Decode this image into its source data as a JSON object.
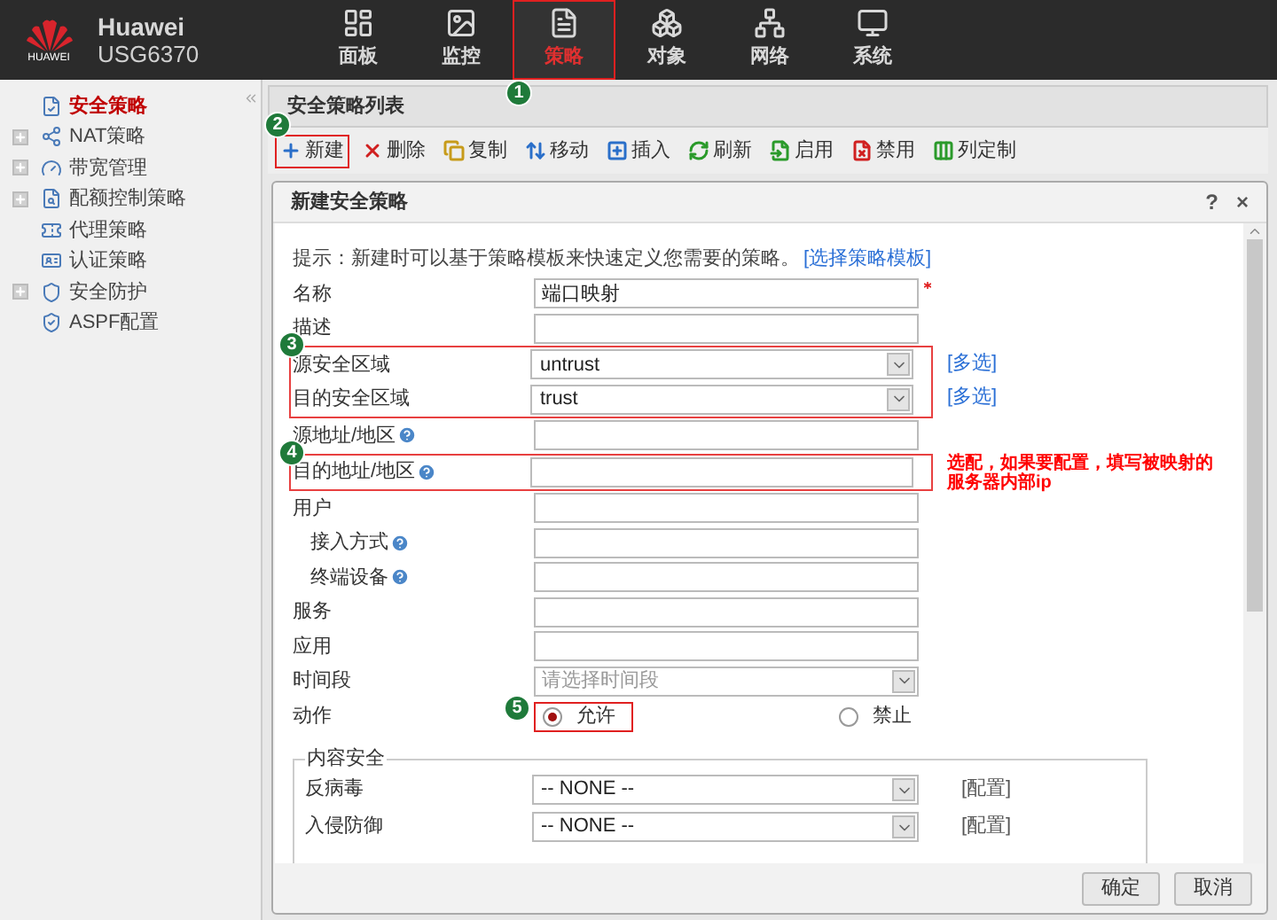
{
  "header": {
    "logo_text": "HUAWEI",
    "brand": "Huawei",
    "model": "USG6370",
    "nav": [
      {
        "label": "面板",
        "selected": false
      },
      {
        "label": "监控",
        "selected": false
      },
      {
        "label": "策略",
        "selected": true,
        "badge": "1"
      },
      {
        "label": "对象",
        "selected": false
      },
      {
        "label": "网络",
        "selected": false
      },
      {
        "label": "系统",
        "selected": false
      }
    ]
  },
  "sidebar": {
    "items": [
      {
        "label": "安全策略",
        "selected": true,
        "expandable": false
      },
      {
        "label": "NAT策略",
        "selected": false,
        "expandable": true
      },
      {
        "label": "带宽管理",
        "selected": false,
        "expandable": true
      },
      {
        "label": "配额控制策略",
        "selected": false,
        "expandable": true
      },
      {
        "label": "代理策略",
        "selected": false,
        "expandable": false
      },
      {
        "label": "认证策略",
        "selected": false,
        "expandable": false
      },
      {
        "label": "安全防护",
        "selected": false,
        "expandable": true
      },
      {
        "label": "ASPF配置",
        "selected": false,
        "expandable": false
      }
    ]
  },
  "panel": {
    "title": "安全策略列表",
    "toolbar": [
      {
        "label": "新建",
        "highlighted": true,
        "badge": "2"
      },
      {
        "label": "删除",
        "highlighted": false
      },
      {
        "label": "复制",
        "highlighted": false
      },
      {
        "label": "移动",
        "highlighted": false
      },
      {
        "label": "插入",
        "highlighted": false
      },
      {
        "label": "刷新",
        "highlighted": false
      },
      {
        "label": "启用",
        "highlighted": false
      },
      {
        "label": "禁用",
        "highlighted": false
      },
      {
        "label": "列定制",
        "highlighted": false
      }
    ]
  },
  "dialog": {
    "title": "新建安全策略",
    "controls": [
      "?",
      "×"
    ],
    "hint": "提示：新建时可以基于策略模板来快速定义您需要的策略。",
    "hint_link": "[选择策略模板]",
    "sections": [
      {
        "highlighted": false,
        "rows": [
          {
            "kind": "text",
            "label": "名称",
            "value": "端口映射",
            "required": true
          },
          {
            "kind": "text",
            "label": "描述"
          }
        ]
      },
      {
        "highlighted": true,
        "badge": "3",
        "rows": [
          {
            "kind": "select",
            "label": "源安全区域",
            "value": "untrust",
            "link": "[多选]"
          },
          {
            "kind": "select",
            "label": "目的安全区域",
            "value": "trust",
            "link": "[多选]"
          }
        ]
      },
      {
        "highlighted": false,
        "rows": [
          {
            "kind": "text",
            "label": "源地址/地区",
            "help": true
          }
        ]
      },
      {
        "highlighted": true,
        "badge": "4",
        "note": "选配，如果要配置，填写被映射的服务器内部ip",
        "rows": [
          {
            "kind": "text",
            "label": "目的地址/地区",
            "help": true
          }
        ]
      },
      {
        "highlighted": false,
        "rows": [
          {
            "kind": "text",
            "label": "用户"
          },
          {
            "kind": "text",
            "label": "接入方式",
            "help": true,
            "indent": true
          },
          {
            "kind": "text",
            "label": "终端设备",
            "help": true,
            "indent": true
          },
          {
            "kind": "text",
            "label": "服务"
          },
          {
            "kind": "text",
            "label": "应用"
          },
          {
            "kind": "select",
            "label": "时间段",
            "placeholder": "请选择时间段"
          }
        ]
      }
    ],
    "action": {
      "label": "动作",
      "options": [
        {
          "label": "允许",
          "selected": true,
          "highlighted": true,
          "badge": "5"
        },
        {
          "label": "禁止",
          "selected": false,
          "highlighted": false
        }
      ]
    },
    "content_security": {
      "title": "内容安全",
      "rows": [
        {
          "label": "反病毒",
          "value": "-- NONE --",
          "link": "[配置]"
        },
        {
          "label": "入侵防御",
          "value": "-- NONE --",
          "link": "[配置]"
        }
      ]
    },
    "buttons": [
      "确定",
      "取消"
    ]
  }
}
